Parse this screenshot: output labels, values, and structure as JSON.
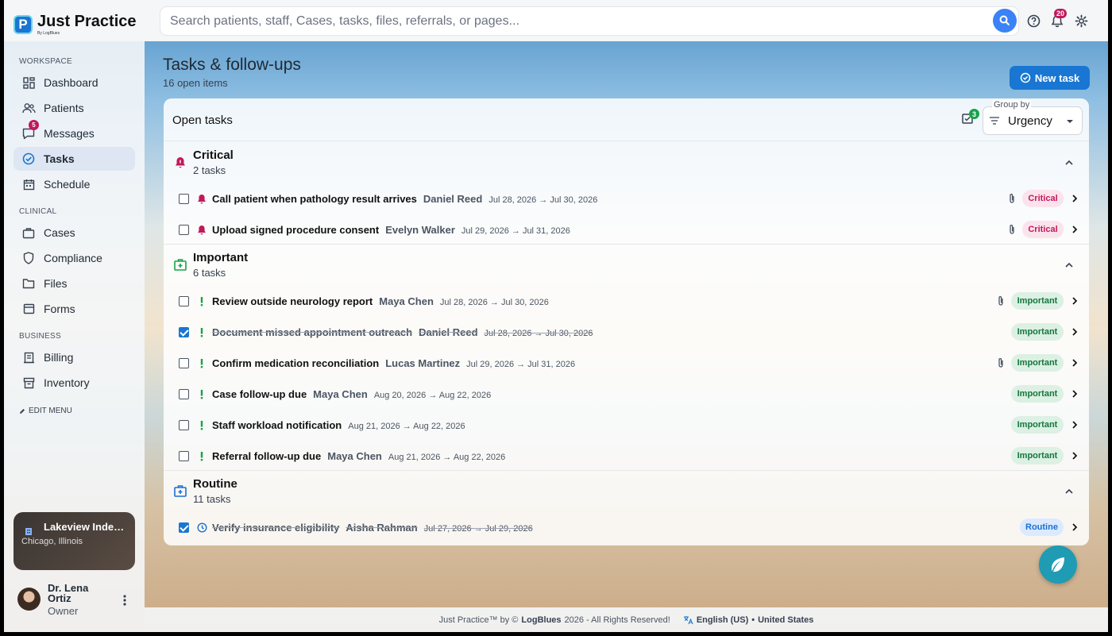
{
  "brand": {
    "title": "Just Practice",
    "subtitle": "By LogBlues",
    "logo_letter": "P"
  },
  "search": {
    "placeholder": "Search patients, staff, Cases, tasks, files, referrals, or pages..."
  },
  "topbar": {
    "notifications_count": "20"
  },
  "sidebar": {
    "sections": {
      "workspace": "WORKSPACE",
      "clinical": "CLINICAL",
      "business": "BUSINESS"
    },
    "items": [
      {
        "label": "Dashboard",
        "icon": "dashboard-icon"
      },
      {
        "label": "Patients",
        "icon": "patients-icon"
      },
      {
        "label": "Messages",
        "icon": "messages-icon",
        "badge": "5"
      },
      {
        "label": "Tasks",
        "icon": "tasks-icon",
        "active": true
      },
      {
        "label": "Schedule",
        "icon": "schedule-icon"
      },
      {
        "label": "Cases",
        "icon": "cases-icon"
      },
      {
        "label": "Compliance",
        "icon": "compliance-icon"
      },
      {
        "label": "Files",
        "icon": "files-icon"
      },
      {
        "label": "Forms",
        "icon": "forms-icon"
      },
      {
        "label": "Billing",
        "icon": "billing-icon"
      },
      {
        "label": "Inventory",
        "icon": "inventory-icon"
      }
    ],
    "edit_menu": "EDIT MENU",
    "clinic": {
      "name": "Lakeview Independent C...",
      "location": "Chicago, Illinois"
    },
    "user": {
      "name": "Dr. Lena Ortiz",
      "role": "Owner"
    }
  },
  "page": {
    "title": "Tasks & follow-ups",
    "subtitle": "16 open items",
    "new_task_label": "New task"
  },
  "panel": {
    "title": "Open tasks",
    "task_badge": "3",
    "group_by_label": "Group by",
    "group_by_value": "Urgency"
  },
  "groups": [
    {
      "title": "Critical",
      "count": "2 tasks",
      "color": "#c2185b",
      "tasks": [
        {
          "title": "Call patient when pathology result arrives",
          "person": "Daniel Reed",
          "dates": "Jul 28, 2026 → Jul 30, 2026",
          "status": "Critical",
          "attachment": true,
          "done": false
        },
        {
          "title": "Upload signed procedure consent",
          "person": "Evelyn Walker",
          "dates": "Jul 29, 2026 → Jul 31, 2026",
          "status": "Critical",
          "attachment": true,
          "done": false
        }
      ]
    },
    {
      "title": "Important",
      "count": "6 tasks",
      "color": "#16a34a",
      "tasks": [
        {
          "title": "Review outside neurology report",
          "person": "Maya Chen",
          "dates": "Jul 28, 2026 → Jul 30, 2026",
          "status": "Important",
          "attachment": true,
          "done": false
        },
        {
          "title": "Document missed appointment outreach",
          "person": "Daniel Reed",
          "dates": "Jul 28, 2026 → Jul 30, 2026",
          "status": "Important",
          "attachment": false,
          "done": true
        },
        {
          "title": "Confirm medication reconciliation",
          "person": "Lucas Martinez",
          "dates": "Jul 29, 2026 → Jul 31, 2026",
          "status": "Important",
          "attachment": true,
          "done": false
        },
        {
          "title": "Case follow-up due",
          "person": "Maya Chen",
          "dates": "Aug 20, 2026 → Aug 22, 2026",
          "status": "Important",
          "attachment": false,
          "done": false
        },
        {
          "title": "Staff workload notification",
          "person": "",
          "dates": "Aug 21, 2026 → Aug 22, 2026",
          "status": "Important",
          "attachment": false,
          "done": false
        },
        {
          "title": "Referral follow-up due",
          "person": "Maya Chen",
          "dates": "Aug 21, 2026 → Aug 22, 2026",
          "status": "Important",
          "attachment": false,
          "done": false
        }
      ]
    },
    {
      "title": "Routine",
      "count": "11 tasks",
      "color": "#1d6fd1",
      "tasks": [
        {
          "title": "Verify insurance eligibility",
          "person": "Aisha Rahman",
          "dates": "Jul 27, 2026 → Jul 29, 2026",
          "status": "Routine",
          "attachment": false,
          "done": true
        }
      ]
    }
  ],
  "footer": {
    "copyright_prefix": "Just Practice™ by ©",
    "brand": "LogBlues",
    "copyright_suffix": "2026 - All Rights Reserved!",
    "language": "English (US)",
    "separator": "•",
    "region": "United States"
  }
}
